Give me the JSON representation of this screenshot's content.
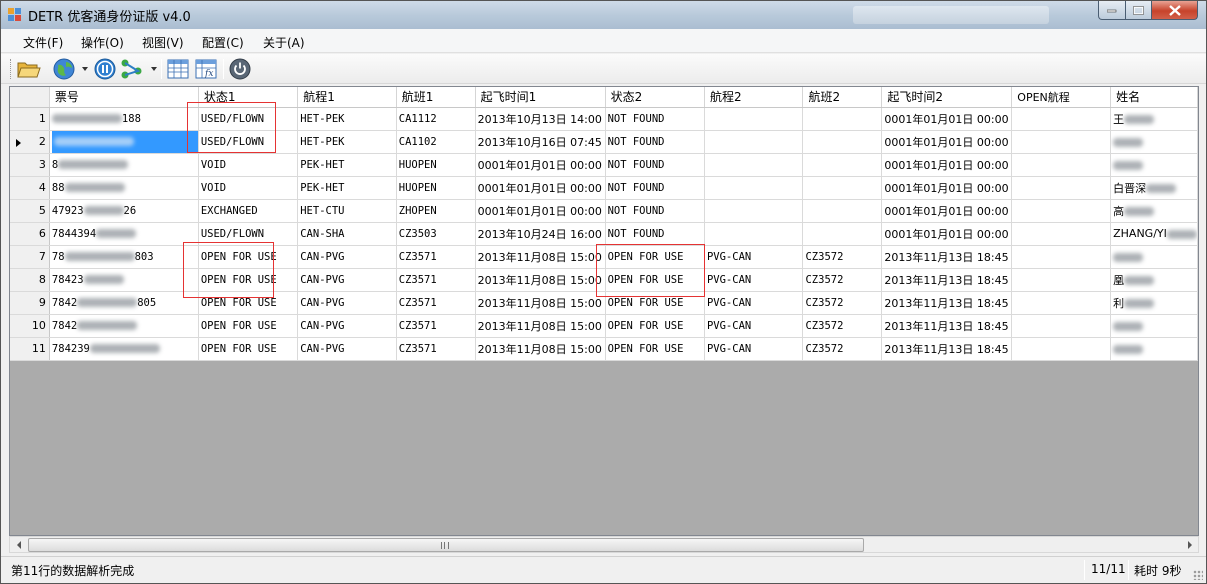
{
  "window": {
    "title": "DETR 优客通身份证版 v4.0"
  },
  "menu": [
    "文件(F)",
    "操作(O)",
    "视图(V)",
    "配置(C)",
    "关于(A)"
  ],
  "toolbar": [
    {
      "name": "open-folder-icon"
    },
    {
      "name": "globe-icon"
    },
    {
      "name": "pause-icon"
    },
    {
      "name": "network-icon"
    },
    {
      "name": "grid-table-icon"
    },
    {
      "name": "formula-sheet-icon"
    },
    {
      "name": "power-icon"
    }
  ],
  "columns": [
    "票号",
    "状态1",
    "航程1",
    "航班1",
    "起飞时间1",
    "状态2",
    "航程2",
    "航班2",
    "起飞时间2",
    "OPEN航程",
    "姓名"
  ],
  "rows": [
    {
      "n": "1",
      "ticket": "",
      "s1": "USED/FLOWN",
      "r1": "HET-PEK",
      "f1": "CA1112",
      "t1": "2013年10月13日 14:00",
      "s2": "NOT FOUND",
      "r2": "",
      "f2": "",
      "t2": "0001年01月01日 00:00",
      "open": "",
      "name": "王"
    },
    {
      "n": "2",
      "ticket": "",
      "s1": "USED/FLOWN",
      "r1": "HET-PEK",
      "f1": "CA1102",
      "t1": "2013年10月16日 07:45",
      "s2": "NOT FOUND",
      "r2": "",
      "f2": "",
      "t2": "0001年01月01日 00:00",
      "open": "",
      "name": ""
    },
    {
      "n": "3",
      "ticket": "8",
      "s1": "VOID",
      "r1": "PEK-HET",
      "f1": "HUOPEN",
      "t1": "0001年01月01日 00:00",
      "s2": "NOT FOUND",
      "r2": "",
      "f2": "",
      "t2": "0001年01月01日 00:00",
      "open": "",
      "name": ""
    },
    {
      "n": "4",
      "ticket": "88",
      "s1": "VOID",
      "r1": "PEK-HET",
      "f1": "HUOPEN",
      "t1": "0001年01月01日 00:00",
      "s2": "NOT FOUND",
      "r2": "",
      "f2": "",
      "t2": "0001年01月01日 00:00",
      "open": "",
      "name": "白晋深"
    },
    {
      "n": "5",
      "ticket": "47923",
      "s1": "EXCHANGED",
      "r1": "HET-CTU",
      "f1": "ZHOPEN",
      "t1": "0001年01月01日 00:00",
      "s2": "NOT FOUND",
      "r2": "",
      "f2": "",
      "t2": "0001年01月01日 00:00",
      "open": "",
      "name": "高"
    },
    {
      "n": "6",
      "ticket": "7844394",
      "s1": "USED/FLOWN",
      "r1": "CAN-SHA",
      "f1": "CZ3503",
      "t1": "2013年10月24日 16:00",
      "s2": "NOT FOUND",
      "r2": "",
      "f2": "",
      "t2": "0001年01月01日 00:00",
      "open": "",
      "name": "ZHANG/YI"
    },
    {
      "n": "7",
      "ticket": "78",
      "s1": "OPEN FOR USE",
      "r1": "CAN-PVG",
      "f1": "CZ3571",
      "t1": "2013年11月08日 15:00",
      "s2": "OPEN FOR USE",
      "r2": "PVG-CAN",
      "f2": "CZ3572",
      "t2": "2013年11月13日 18:45",
      "open": "",
      "name": ""
    },
    {
      "n": "8",
      "ticket": "78423",
      "s1": "OPEN FOR USE",
      "r1": "CAN-PVG",
      "f1": "CZ3571",
      "t1": "2013年11月08日 15:00",
      "s2": "OPEN FOR USE",
      "r2": "PVG-CAN",
      "f2": "CZ3572",
      "t2": "2013年11月13日 18:45",
      "open": "",
      "name": "凰"
    },
    {
      "n": "9",
      "ticket": "7842",
      "s1": "OPEN FOR USE",
      "r1": "CAN-PVG",
      "f1": "CZ3571",
      "t1": "2013年11月08日 15:00",
      "s2": "OPEN FOR USE",
      "r2": "PVG-CAN",
      "f2": "CZ3572",
      "t2": "2013年11月13日 18:45",
      "open": "",
      "name": "利"
    },
    {
      "n": "10",
      "ticket": "7842",
      "s1": "OPEN FOR USE",
      "r1": "CAN-PVG",
      "f1": "CZ3571",
      "t1": "2013年11月08日 15:00",
      "s2": "OPEN FOR USE",
      "r2": "PVG-CAN",
      "f2": "CZ3572",
      "t2": "2013年11月13日 18:45",
      "open": "",
      "name": ""
    },
    {
      "n": "11",
      "ticket": "784239",
      "s1": "OPEN FOR USE",
      "r1": "CAN-PVG",
      "f1": "CZ3571",
      "t1": "2013年11月08日 15:00",
      "s2": "OPEN FOR USE",
      "r2": "PVG-CAN",
      "f2": "CZ3572",
      "t2": "2013年11月13日 18:45",
      "open": "",
      "name": ""
    }
  ],
  "ticket_tails": {
    "1": "188",
    "4": "",
    "5": "26",
    "7": "803",
    "9": "805"
  },
  "status": {
    "message": "第11行的数据解析完成",
    "count": "11/11",
    "elapsed": "耗时 9秒"
  }
}
